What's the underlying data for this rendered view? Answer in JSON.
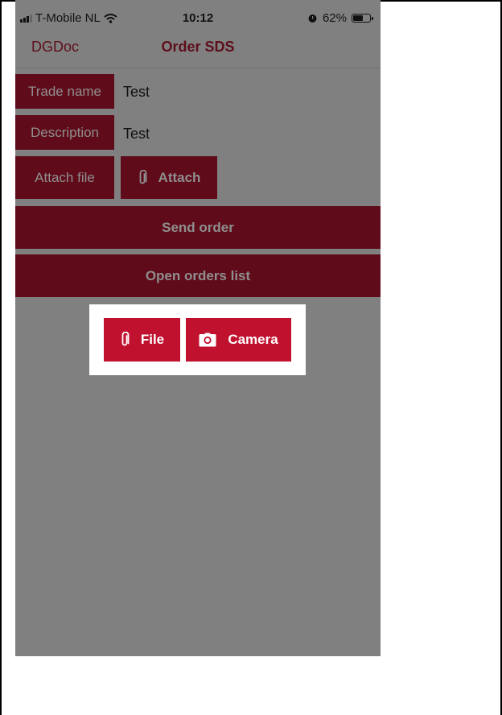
{
  "status_bar": {
    "carrier": "T-Mobile NL",
    "time": "10:12",
    "battery_text": "62%",
    "battery_level": 0.62,
    "icons": [
      "signal-icon",
      "wifi-icon",
      "alarm-icon",
      "battery-icon"
    ]
  },
  "nav": {
    "back_label": "DGDoc",
    "title": "Order SDS"
  },
  "form": {
    "trade_name_label": "Trade name",
    "trade_name_value": "Test",
    "description_label": "Description",
    "description_value": "Test",
    "attach_file_label": "Attach file",
    "attach_button_label": "Attach"
  },
  "actions": {
    "send_order_label": "Send order",
    "open_orders_label": "Open orders list"
  },
  "popup": {
    "file_label": "File",
    "camera_label": "Camera"
  },
  "colors": {
    "dark_button": "#5f0b1a",
    "overlay": "#808080",
    "popup_button": "#c0122f",
    "nav_text": "#5e0f1b"
  }
}
